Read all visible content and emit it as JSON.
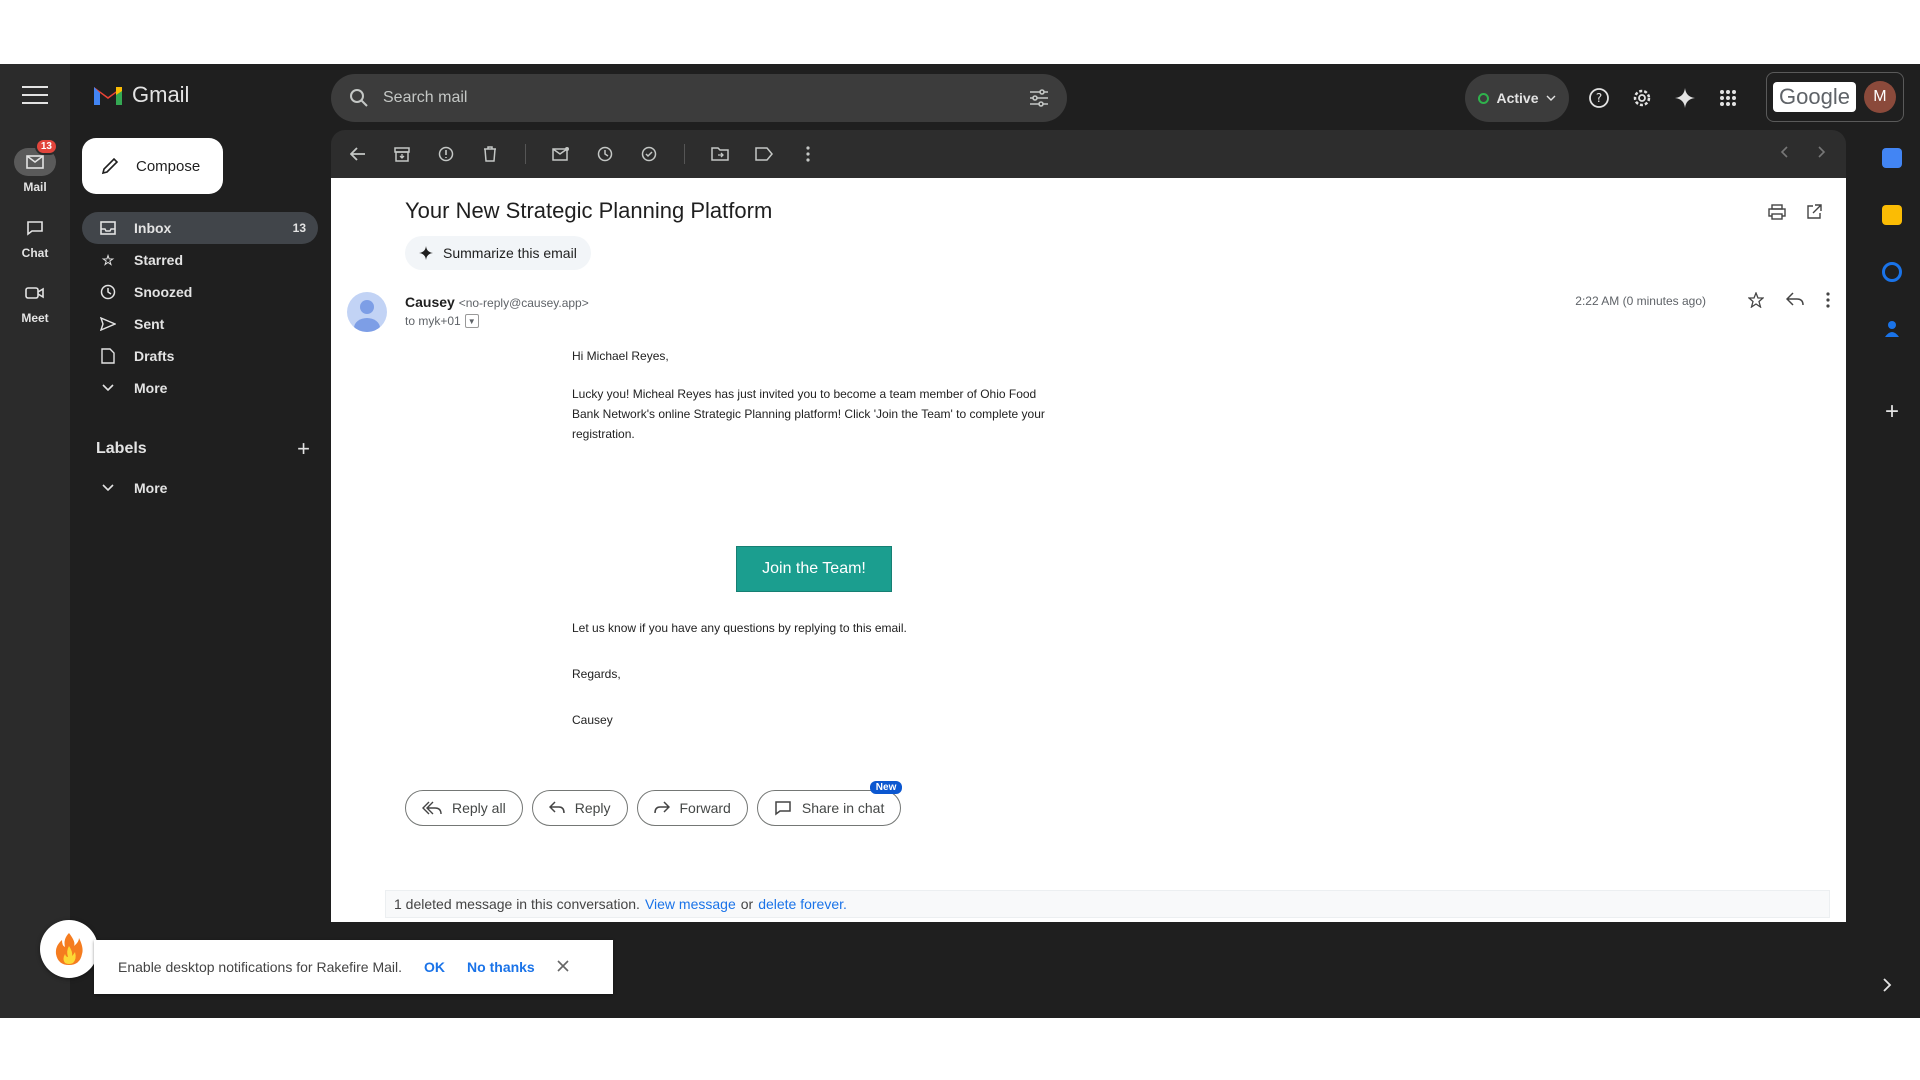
{
  "app": {
    "name": "Gmail"
  },
  "rail": {
    "items": [
      {
        "label": "Mail",
        "badge": "13"
      },
      {
        "label": "Chat"
      },
      {
        "label": "Meet"
      }
    ]
  },
  "compose_label": "Compose",
  "nav": {
    "items": [
      {
        "label": "Inbox",
        "count": "13"
      },
      {
        "label": "Starred"
      },
      {
        "label": "Snoozed"
      },
      {
        "label": "Sent"
      },
      {
        "label": "Drafts"
      },
      {
        "label": "More"
      }
    ]
  },
  "labels": {
    "title": "Labels",
    "more": "More"
  },
  "search": {
    "placeholder": "Search mail"
  },
  "status": {
    "label": "Active"
  },
  "account": {
    "brand": "Google",
    "initial": "M"
  },
  "email": {
    "subject": "Your New Strategic Planning Platform",
    "summarize_label": "Summarize this email",
    "sender_name": "Causey",
    "sender_email": "<no-reply@causey.app>",
    "to": "to myk+01",
    "time": "2:22 AM (0 minutes ago)",
    "greeting": "Hi Michael Reyes,",
    "paragraph": "Lucky you! Micheal Reyes has just invited you to become a team member of Ohio Food Bank Network's online Strategic Planning platform! Click 'Join the Team' to complete your registration.",
    "cta": "Join the Team!",
    "questions": "Let us know if you have any questions by replying to this email.",
    "regards": "Regards,",
    "signature": "Causey"
  },
  "actions": {
    "reply_all": "Reply all",
    "reply": "Reply",
    "forward": "Forward",
    "share": "Share in chat",
    "new_badge": "New"
  },
  "deleted": {
    "text": "1 deleted message in this conversation.",
    "view": "View message",
    "or": "or",
    "delete": "delete forever."
  },
  "notification": {
    "text": "Enable desktop notifications for Rakefire Mail.",
    "ok": "OK",
    "no": "No thanks"
  },
  "colors": {
    "accent_cta": "#1b9e8f",
    "dark_bg": "#1f1f1f",
    "link": "#1a73e8"
  }
}
